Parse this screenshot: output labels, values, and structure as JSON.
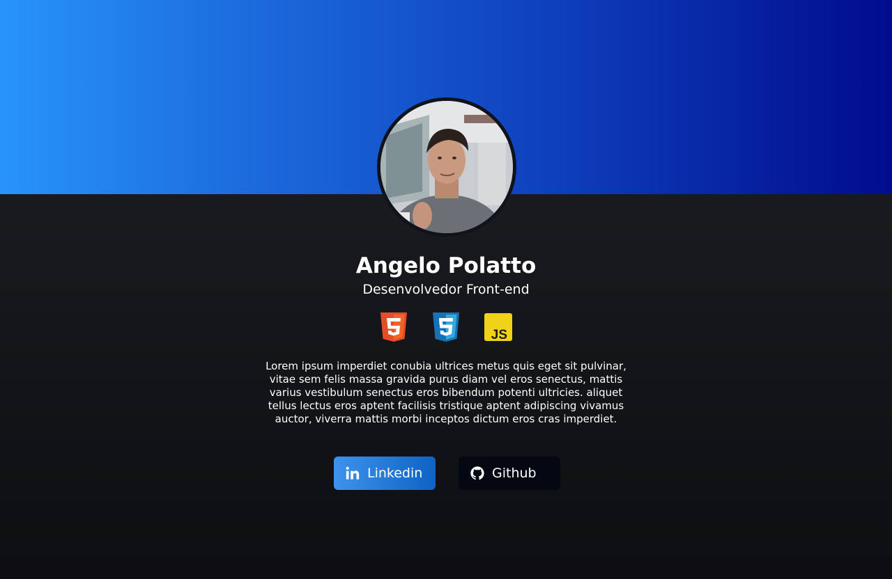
{
  "profile": {
    "name": "Angelo Polatto",
    "role": "Desenvolvedor Front-end",
    "avatar_alt": "profile-photo",
    "bio": "Lorem ipsum imperdiet conubia ultrices metus quis eget sit pulvinar, vitae sem felis massa gravida purus diam vel eros senectus, mattis varius vestibulum senectus eros bibendum potenti ultricies. aliquet tellus lectus eros aptent facilisis tristique aptent adipiscing vivamus auctor, viverra mattis morbi inceptos dictum eros cras imperdiet."
  },
  "techs": [
    {
      "icon": "html5-icon",
      "color": "#e44d26"
    },
    {
      "icon": "css3-icon",
      "color": "#1b9fd8"
    },
    {
      "icon": "javascript-icon",
      "color": "#f0d318",
      "text": "JS"
    }
  ],
  "links": {
    "linkedin": {
      "label": "Linkedin",
      "icon": "linkedin-icon"
    },
    "github": {
      "label": "Github",
      "icon": "github-icon"
    }
  },
  "colors": {
    "banner_start": "#2894fb",
    "banner_end": "#000c8d",
    "background_top": "#1f2124",
    "background_bottom": "#0d0e11",
    "linkedin_button": "#0e63c3",
    "github_button": "#030812"
  }
}
